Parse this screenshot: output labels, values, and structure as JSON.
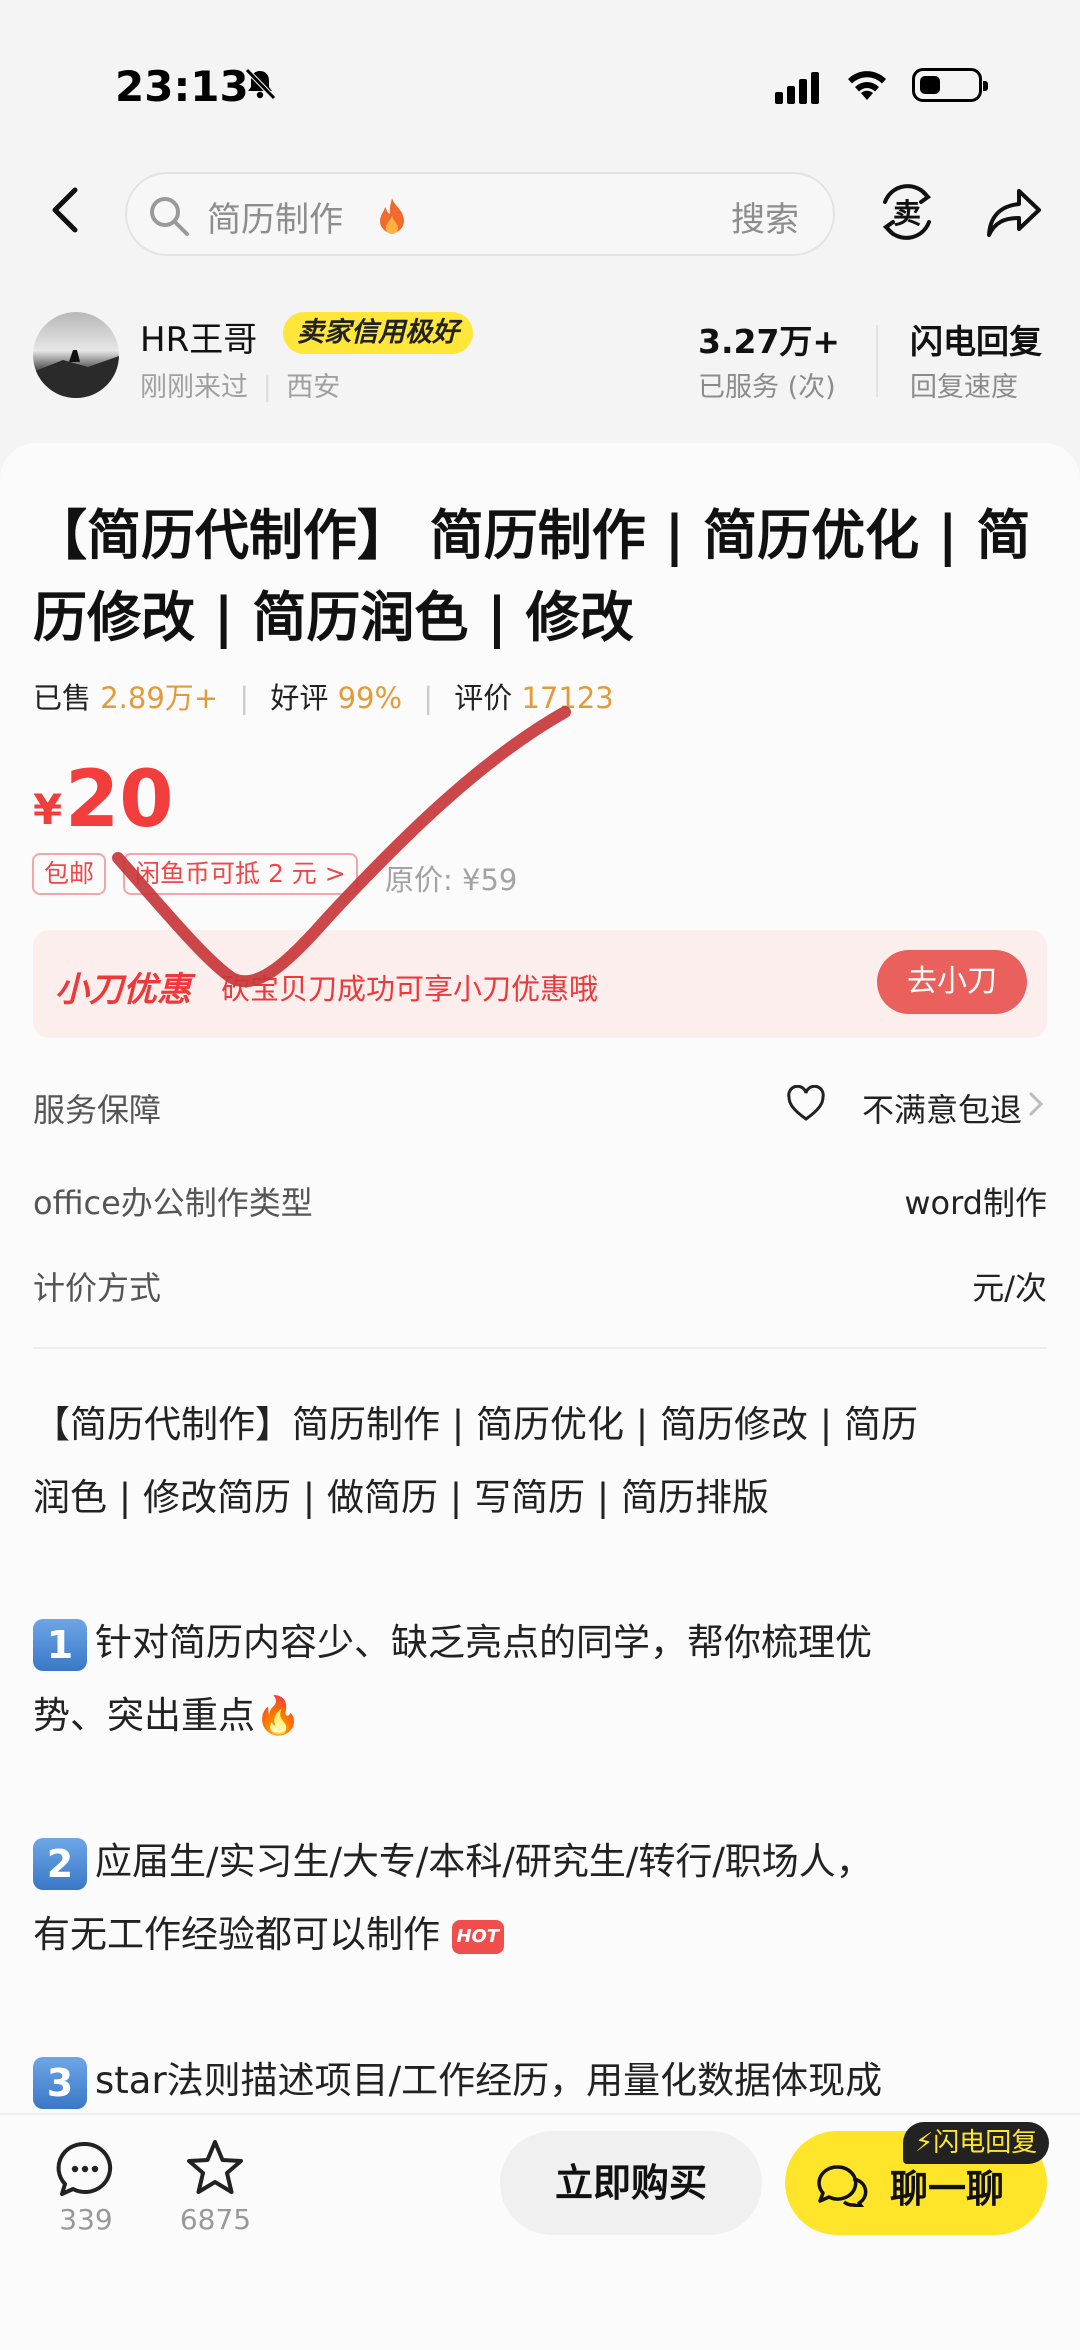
{
  "status_bar": {
    "time": "23:13"
  },
  "search": {
    "query": "简历制作",
    "submit_label": "搜索"
  },
  "header": {
    "sell_label": "卖"
  },
  "seller": {
    "name": "HR王哥",
    "badge": "卖家信用极好",
    "last_seen": "刚刚来过",
    "location": "西安",
    "served_value": "3.27万+",
    "served_label": "已服务 (次)",
    "reply_value": "闪电回复",
    "reply_label": "回复速度"
  },
  "product": {
    "title": "【简历代制作】 简历制作 | 简历优化 | 简历修改 | 简历润色 | 修改",
    "sold_label": "已售",
    "sold_value": "2.89万+",
    "rating_label": "好评",
    "rating_value": "99%",
    "reviews_label": "评价",
    "reviews_value": "17123",
    "currency": "¥",
    "price": "20",
    "shipping_tag": "包邮",
    "coin_tag": "闲鱼币可抵 2 元 >",
    "original_price": "原价: ¥59"
  },
  "promo": {
    "title": "小刀优惠",
    "text": "砍宝贝刀成功可享小刀优惠哦",
    "button": "去小刀"
  },
  "attributes": {
    "service_label": "服务保障",
    "service_value": "不满意包退",
    "type_label": "office办公制作类型",
    "type_value": "word制作",
    "pricing_label": "计价方式",
    "pricing_value": "元/次"
  },
  "description": {
    "intro_1": "【简历代制作】简历制作 | 简历优化 | 简历修改 | 简历",
    "intro_2": "润色 | 修改简历 | 做简历 | 写简历 | 简历排版",
    "p1_num": "1",
    "p1_line1": "针对简历内容少、缺乏亮点的同学，帮你梳理优",
    "p1_line2": "势、突出重点🔥",
    "p2_num": "2",
    "p2_line1": "应届生/实习生/大专/本科/研究生/转行/职场人，",
    "p2_line2": "有无工作经验都可以制作",
    "hot_badge": "HOT",
    "p3_num": "3",
    "p3_line1": "star法则描述项目/工作经历，用量化数据体现成"
  },
  "bottom_bar": {
    "comments": "339",
    "favorites": "6875",
    "buy": "立即购买",
    "chat": "聊一聊",
    "flash_tag": "⚡闪电回复"
  },
  "colors": {
    "price_red": "#f23d3d",
    "highlight_orange": "#e39b3a",
    "badge_yellow": "#ffe63a",
    "chat_yellow": "#ffe529",
    "annotation_red": "#c8373a"
  }
}
